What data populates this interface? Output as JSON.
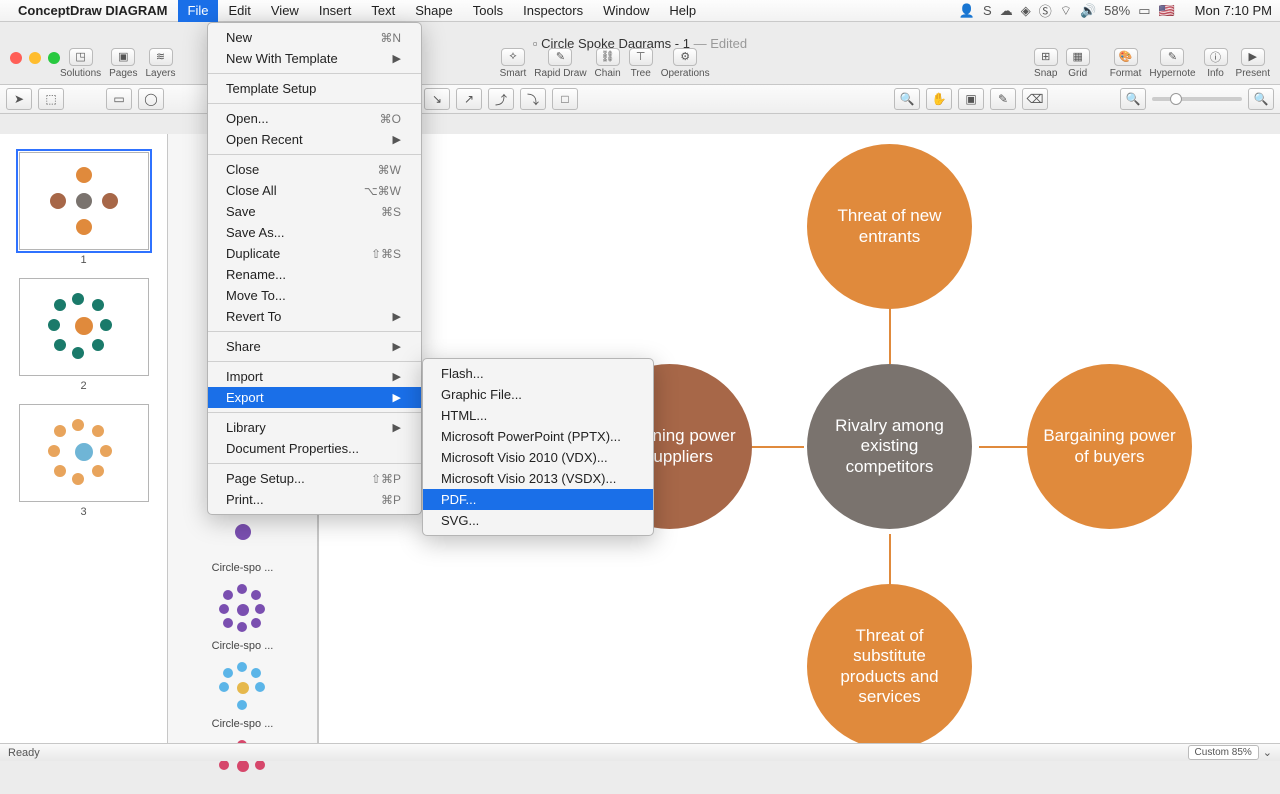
{
  "menubar": {
    "app": "ConceptDraw DIAGRAM",
    "items": [
      "File",
      "Edit",
      "View",
      "Insert",
      "Text",
      "Shape",
      "Tools",
      "Inspectors",
      "Window",
      "Help"
    ],
    "battery": "58%",
    "clock": "Mon 7:10 PM"
  },
  "window": {
    "title": "Circle  Spoke Dagrams - 1",
    "edited": " — Edited"
  },
  "toolbar": {
    "left": [
      {
        "label": "Solutions"
      },
      {
        "label": "Pages"
      },
      {
        "label": "Layers"
      }
    ],
    "mid": [
      {
        "label": "Smart"
      },
      {
        "label": "Rapid Draw"
      },
      {
        "label": "Chain"
      },
      {
        "label": "Tree"
      },
      {
        "label": "Operations"
      }
    ],
    "right1": [
      {
        "label": "Snap"
      },
      {
        "label": "Grid"
      }
    ],
    "right2": [
      {
        "label": "Format"
      },
      {
        "label": "Hypernote"
      },
      {
        "label": "Info"
      },
      {
        "label": "Present"
      }
    ]
  },
  "pages": [
    "1",
    "2",
    "3"
  ],
  "library": {
    "items": [
      "Circle-spo ...",
      "Circle-spo ...",
      "Circle-spo ..."
    ]
  },
  "diagram": {
    "center": "Rivalry among existing competitors",
    "top": "Threat of new entrants",
    "bottom": "Threat of substitute products and services",
    "left": "Bargaining power of suppliers",
    "right": "Bargaining power of buyers"
  },
  "file_menu": [
    {
      "t": "New",
      "sc": "⌘N"
    },
    {
      "t": "New With Template",
      "sub": true
    },
    {
      "sep": true
    },
    {
      "t": "Template Setup"
    },
    {
      "sep": true
    },
    {
      "t": "Open...",
      "sc": "⌘O"
    },
    {
      "t": "Open Recent",
      "sub": true
    },
    {
      "sep": true
    },
    {
      "t": "Close",
      "sc": "⌘W"
    },
    {
      "t": "Close All",
      "sc": "⌥⌘W"
    },
    {
      "t": "Save",
      "sc": "⌘S"
    },
    {
      "t": "Save As..."
    },
    {
      "t": "Duplicate",
      "sc": "⇧⌘S"
    },
    {
      "t": "Rename..."
    },
    {
      "t": "Move To..."
    },
    {
      "t": "Revert To",
      "sub": true
    },
    {
      "sep": true
    },
    {
      "t": "Share",
      "sub": true
    },
    {
      "sep": true
    },
    {
      "t": "Import",
      "sub": true
    },
    {
      "t": "Export",
      "sub": true,
      "sel": true
    },
    {
      "sep": true
    },
    {
      "t": "Library",
      "sub": true
    },
    {
      "t": "Document Properties..."
    },
    {
      "sep": true
    },
    {
      "t": "Page Setup...",
      "sc": "⇧⌘P"
    },
    {
      "t": "Print...",
      "sc": "⌘P"
    }
  ],
  "export_menu": [
    {
      "t": "Flash..."
    },
    {
      "t": "Graphic File..."
    },
    {
      "t": "HTML..."
    },
    {
      "t": "Microsoft PowerPoint (PPTX)..."
    },
    {
      "t": "Microsoft Visio 2010 (VDX)..."
    },
    {
      "t": "Microsoft Visio 2013 (VSDX)..."
    },
    {
      "t": "PDF...",
      "sel": true
    },
    {
      "t": "SVG..."
    }
  ],
  "status": {
    "ready": "Ready",
    "zoom": "Custom 85%"
  }
}
